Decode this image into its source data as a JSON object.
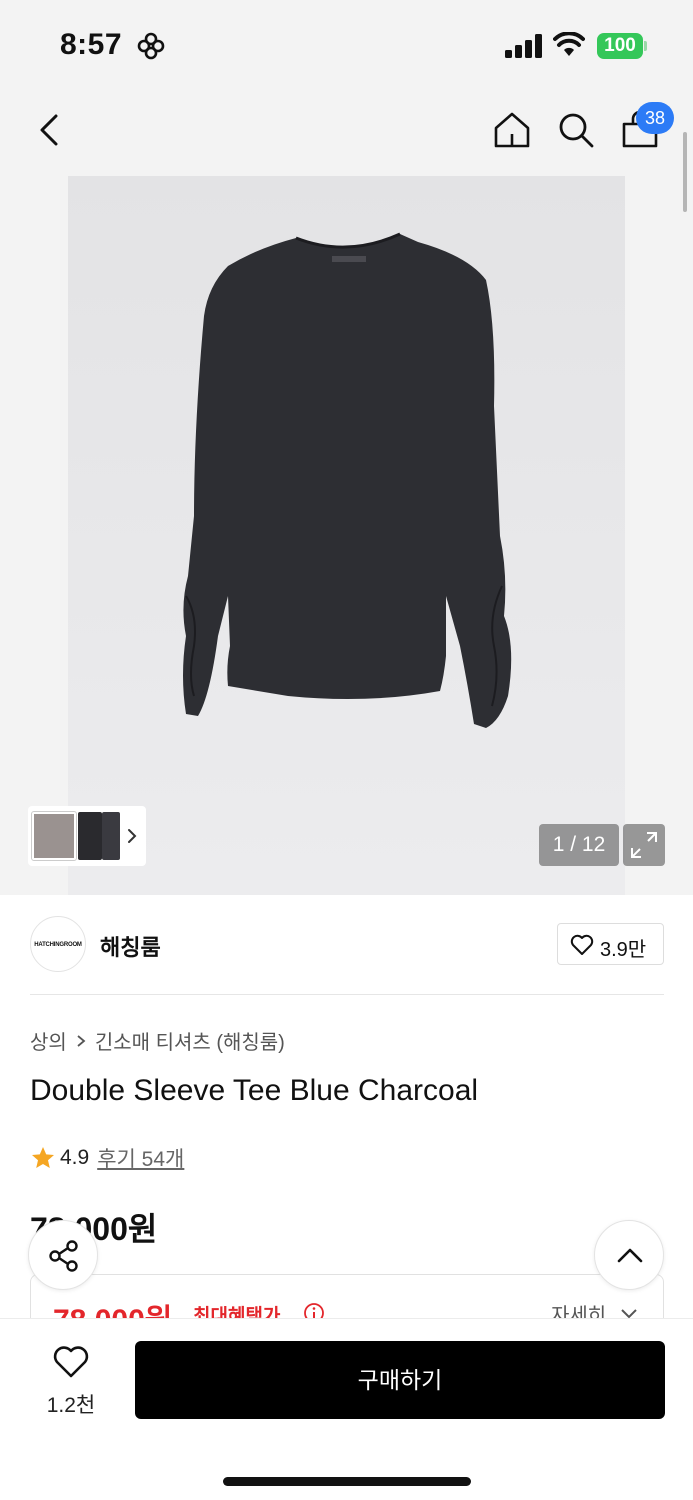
{
  "status_bar": {
    "time": "8:57",
    "battery": "100"
  },
  "header": {
    "cart_count": "38"
  },
  "gallery": {
    "page_counter": "1 / 12"
  },
  "brand": {
    "logo_text": "HATCHINGROOM",
    "name": "해칭룸",
    "likes": "3.9만"
  },
  "breadcrumb": {
    "category": "상의",
    "subcategory": "긴소매 티셔츠 (해칭룸)"
  },
  "product": {
    "title": "Double Sleeve Tee Blue Charcoal",
    "rating": "4.9",
    "reviews_label": "후기 54개",
    "price": "78,000원"
  },
  "benefit": {
    "price": "78,000원",
    "label": "최대혜택가",
    "detail_label": "자세히"
  },
  "bottom_bar": {
    "wish_count": "1.2천",
    "buy_label": "구매하기"
  },
  "colors": {
    "accent_red": "#e3262b",
    "badge_blue": "#2c7bf6",
    "star": "#f5a623",
    "battery_green": "#34c759"
  },
  "icons": [
    "focus-icon",
    "signal-icon",
    "wifi-icon",
    "battery-icon",
    "back-icon",
    "home-icon",
    "search-icon",
    "bag-icon",
    "chevron-right-icon",
    "expand-icon",
    "heart-icon",
    "star-icon",
    "info-icon",
    "chevron-down-icon",
    "share-icon",
    "chevron-up-icon"
  ]
}
